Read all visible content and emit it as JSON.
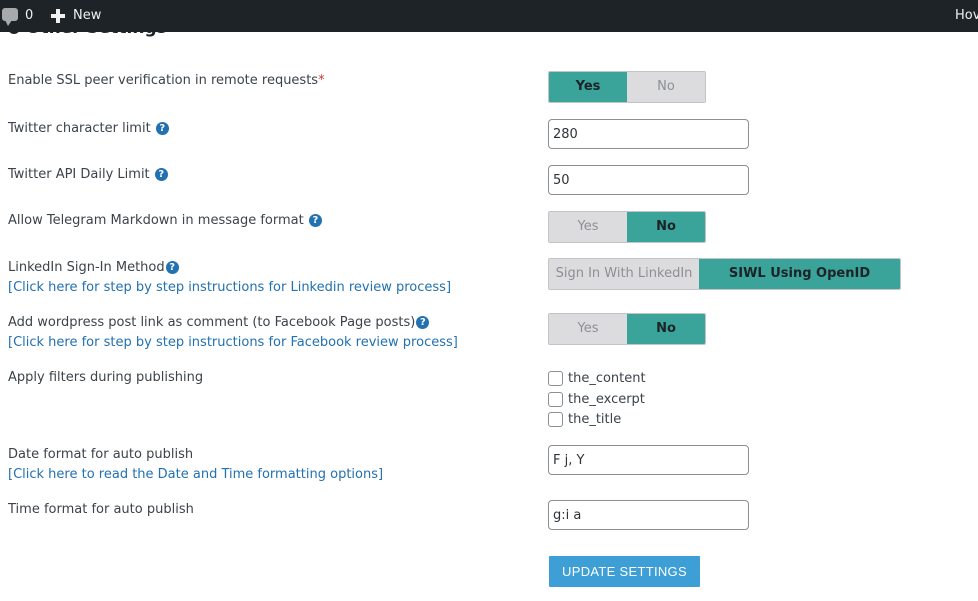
{
  "adminbar": {
    "comment_count": "0",
    "new_label": "New",
    "howdy": "Hov"
  },
  "section": {
    "heading": "Other Settings"
  },
  "settings": {
    "ssl": {
      "label": "Enable SSL peer verification in remote requests",
      "required_mark": "*",
      "options": [
        "Yes",
        "No"
      ],
      "selected": "Yes"
    },
    "twitter_char_limit": {
      "label": "Twitter character limit",
      "value": "280"
    },
    "twitter_api_limit": {
      "label": "Twitter API Daily Limit",
      "value": "50"
    },
    "telegram_markdown": {
      "label": "Allow Telegram Markdown in message format",
      "options": [
        "Yes",
        "No"
      ],
      "selected": "No"
    },
    "linkedin_signin": {
      "label": "LinkedIn Sign-In Method",
      "link": "[Click here for step by step instructions for Linkedin review process]",
      "options": [
        "Sign In With LinkedIn",
        "SIWL Using OpenID Connect"
      ],
      "selected": "SIWL Using OpenID Connect"
    },
    "fb_post_link": {
      "label": "Add wordpress post link as comment (to Facebook Page posts)",
      "link": "[Click here for step by step instructions for Facebook review process]",
      "options": [
        "Yes",
        "No"
      ],
      "selected": "No"
    },
    "filters": {
      "label": "Apply filters during publishing",
      "options": [
        {
          "label": "the_content",
          "checked": false
        },
        {
          "label": "the_excerpt",
          "checked": false
        },
        {
          "label": "the_title",
          "checked": false
        }
      ]
    },
    "date_format": {
      "label": "Date format for auto publish",
      "link": "[Click here to read the Date and Time formatting options]",
      "value": "F j, Y"
    },
    "time_format": {
      "label": "Time format for auto publish",
      "value": "g:i a"
    }
  },
  "help_icon_glyph": "?",
  "update_button": "UPDATE SETTINGS",
  "colors": {
    "accent": "#3aa39a",
    "button": "#3e9fd6",
    "link": "#2271b1",
    "adminbar": "#1d2327"
  }
}
